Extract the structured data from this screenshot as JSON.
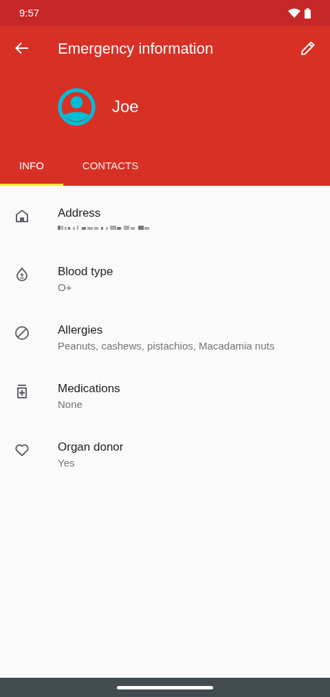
{
  "status_bar": {
    "time": "9:57"
  },
  "app_bar": {
    "title": "Emergency information"
  },
  "profile": {
    "name": "Joe"
  },
  "tabs": [
    {
      "label": "INFO",
      "selected": true
    },
    {
      "label": "CONTACTS",
      "selected": false
    }
  ],
  "info_items": [
    {
      "label": "Address",
      "kind": "redacted"
    },
    {
      "label": "Blood type",
      "kind": "text",
      "value": "O+"
    },
    {
      "label": "Allergies",
      "kind": "text",
      "value": "Peanuts, cashews, pistachios, Macadamia nuts"
    },
    {
      "label": "Medications",
      "kind": "text",
      "value": "None"
    },
    {
      "label": "Organ donor",
      "kind": "text",
      "value": "Yes"
    }
  ]
}
